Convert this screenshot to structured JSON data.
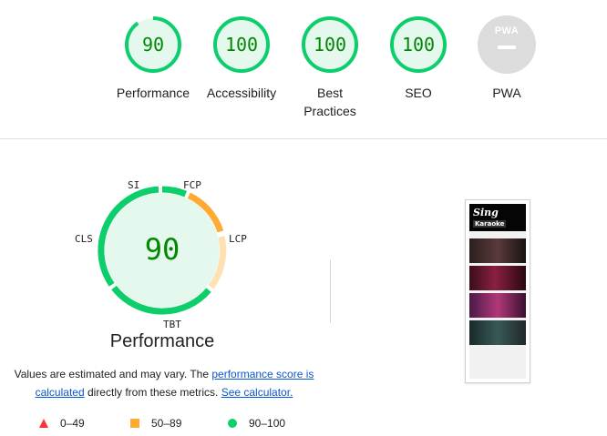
{
  "categories": [
    {
      "label": "Performance",
      "score": "90",
      "score_fraction": 0.9
    },
    {
      "label": "Accessibility",
      "score": "100",
      "score_fraction": 1.0
    },
    {
      "label": "Best Practices",
      "score": "100",
      "score_fraction": 1.0
    },
    {
      "label": "SEO",
      "score": "100",
      "score_fraction": 1.0
    },
    {
      "label": "PWA",
      "badge": "PWA"
    }
  ],
  "performance": {
    "score": "90",
    "title": "Performance",
    "metrics": [
      "SI",
      "FCP",
      "LCP",
      "TBT",
      "CLS"
    ]
  },
  "description": {
    "before": "Values are estimated and may vary. The ",
    "link1": "performance score is calculated",
    "middle": " directly from these metrics. ",
    "link2": "See calculator."
  },
  "legend": [
    {
      "range": "0–49",
      "color": "#ff3333",
      "shape": "triangle"
    },
    {
      "range": "50–89",
      "color": "#ffaa33",
      "shape": "square"
    },
    {
      "range": "90–100",
      "color": "#0cce6b",
      "shape": "circle"
    }
  ],
  "screenshot": {
    "title": "Sing",
    "subtitle": "Karaoke"
  },
  "colors": {
    "pass": "#0cce6b",
    "pass_text": "#008800",
    "pass_bg": "#e5f8ee",
    "average": "#ffaa33",
    "average_light": "#ffe0b3",
    "na": "#dcdcdc"
  }
}
